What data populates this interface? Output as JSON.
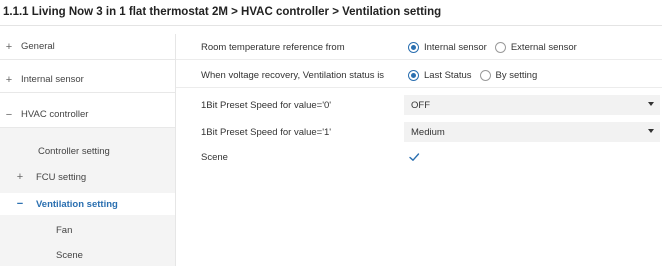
{
  "title": "1.1.1 Living Now 3 in 1 flat thermostat 2M > HVAC controller > Ventilation setting",
  "sidebar": {
    "items": [
      {
        "sign": "+",
        "label": "General"
      },
      {
        "sign": "+",
        "label": "Internal sensor"
      },
      {
        "sign": "−",
        "label": "HVAC controller"
      },
      {
        "sign": "",
        "label": "Controller setting"
      },
      {
        "sign": "+",
        "label": "FCU setting"
      },
      {
        "sign": "−",
        "label": "Ventilation setting"
      },
      {
        "sign": "",
        "label": "Fan"
      },
      {
        "sign": "",
        "label": "Scene"
      }
    ]
  },
  "settings": {
    "room_temp": {
      "label": "Room temperature reference from",
      "options": [
        "Internal sensor",
        "External sensor"
      ],
      "selected": "Internal sensor"
    },
    "voltage_recovery": {
      "label": "When voltage recovery, Ventilation status is",
      "options": [
        "Last Status",
        "By setting"
      ],
      "selected": "Last Status"
    },
    "preset0": {
      "label": "1Bit Preset Speed for value='0'",
      "value": "OFF"
    },
    "preset1": {
      "label": "1Bit Preset Speed for value='1'",
      "value": "Medium"
    },
    "scene": {
      "label": "Scene",
      "checked": true
    }
  },
  "colors": {
    "accent": "#2a6fb0",
    "selected_bg": "#f4f4f4",
    "field_bg": "#f2f2f2"
  }
}
